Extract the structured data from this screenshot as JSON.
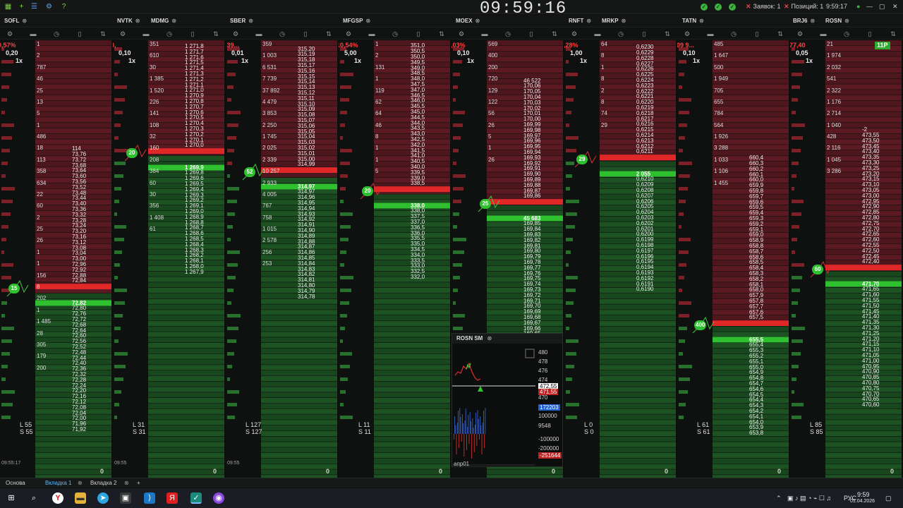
{
  "clock": "09:59:16",
  "status": {
    "orders_label": "Заявок: 1",
    "positions_label": "Позиций: 1",
    "server_time": "9:59:17"
  },
  "tickers": [
    {
      "name": "SOFL"
    },
    {
      "name": "NVTK"
    },
    {
      "name": "MDMG"
    },
    {
      "name": "SBER"
    },
    {
      "name": "MFGSP"
    },
    {
      "name": "MOEX"
    },
    {
      "name": "RNFT"
    },
    {
      "name": "MRKP"
    },
    {
      "name": "TATN"
    },
    {
      "name": "BRJ6"
    },
    {
      "name": "ROSN"
    }
  ],
  "panels": [
    {
      "sym": "SOFL",
      "spread_pct": "-0,57%",
      "step": "0,20",
      "mult": "1x",
      "l": "L 55",
      "s": "S 55",
      "zero": "0",
      "time": "09:55:17",
      "asks": [
        "114",
        "73,76",
        "73,72",
        "73,68",
        "73,64",
        "73,60",
        "73,56",
        "73,52",
        "73,48",
        "73,44",
        "73,40",
        "73,36",
        "73,32",
        "73,28",
        "73,24",
        "73,20",
        "73,16",
        "73,12",
        "73,08",
        "73,04",
        "73,00",
        "72,96",
        "72,92",
        "72,88",
        "72,84"
      ],
      "bids": [
        "72,80",
        "72,76",
        "72,72",
        "72,68",
        "72,64",
        "72,60",
        "72,56",
        "72,52",
        "72,48",
        "72,44",
        "72,40",
        "72,36",
        "72,32",
        "72,28",
        "72,24",
        "72,20",
        "72,16",
        "72,12",
        "72,08",
        "72,04",
        "72,00",
        "71,96",
        "71,92"
      ],
      "sizes": [
        "1",
        "2",
        "787",
        "46",
        "25",
        "13",
        "5",
        "1",
        "486",
        "18",
        "113",
        "358",
        "634",
        "22",
        "60",
        "2",
        "25",
        "26",
        "1",
        "1",
        "156",
        "8",
        "202",
        "1",
        "1 485",
        "28",
        "305",
        "179",
        "200"
      ],
      "bestbid": "72,82",
      "marker": "15"
    },
    {
      "sym": "MDMG",
      "spread_pct": "-0,",
      "step": "0,10",
      "mult": "1x",
      "l": "L 31",
      "s": "S 31",
      "zero": "0",
      "time": "09:55",
      "asks": [
        "1 276",
        "1 271,9",
        "1 271,8",
        "1 271,7",
        "1 271,6",
        "1 271,5",
        "1 271,4",
        "1 271,3",
        "1 271,2",
        "1 271,1",
        "1 271,0",
        "1 270,9",
        "1 270,8",
        "1 270,7",
        "1 270,6",
        "1 270,5",
        "1 270,4",
        "1 270,3",
        "1 270,2",
        "1 270,1",
        "1 270,0"
      ],
      "bids": [
        "1 269,8",
        "1 269,6",
        "1 269,5",
        "1 269,4",
        "1 269,3",
        "1 269,2",
        "1 269,1",
        "1 269,0",
        "1 268,9",
        "1 268,8",
        "1 268,7",
        "1 268,6",
        "1 268,5",
        "1 268,4",
        "1 268,3",
        "1 268,2",
        "1 268,1",
        "1 268,0",
        "1 267,9"
      ],
      "sizes": [
        "351",
        "610",
        "30",
        "1 385",
        "1 520",
        "226",
        "141",
        "108",
        "32",
        "160",
        "208",
        "384",
        "60",
        "30",
        "356",
        "1 408",
        "61"
      ],
      "bestbid": "1 269,9",
      "marker": "20"
    },
    {
      "sym": "SBER",
      "spread_pct": "3 39...",
      "step": "0,01",
      "mult": "1x",
      "l": "L 127",
      "s": "S 127",
      "zero": "0",
      "time": "09:55",
      "asks": [
        "315,20",
        "315,19",
        "315,18",
        "315,17",
        "315,16",
        "315,15",
        "315,14",
        "315,13",
        "315,12",
        "315,11",
        "315,10",
        "315,09",
        "315,08",
        "315,07",
        "315,06",
        "315,05",
        "315,04",
        "315,03",
        "315,02",
        "315,01",
        "315,00",
        "314,99"
      ],
      "bids": [
        "314,97",
        "314,96",
        "314,95",
        "314,94",
        "314,93",
        "314,92",
        "314,91",
        "314,90",
        "314,89",
        "314,88",
        "314,87",
        "314,86",
        "314,85",
        "314,84",
        "314,83",
        "314,82",
        "314,81",
        "314,80",
        "314,79",
        "314,78"
      ],
      "sizes": [
        "359",
        "1 003",
        "6 531",
        "7 739",
        "37 892",
        "4 479",
        "3 853",
        "2 250",
        "1 745",
        "2 025",
        "2 339",
        "10 257",
        "2 933",
        "4 005",
        "767",
        "758",
        "1 015",
        "2 578",
        "256",
        "253"
      ],
      "bestbid": "314,97",
      "marker": "52"
    },
    {
      "sym": "MFGSP",
      "spread_pct": "-10,54%",
      "step": "5,00",
      "mult": "1x",
      "l": "L 11",
      "s": "S 11",
      "zero": "0",
      "time": "",
      "asks": [
        "2 358",
        "351,0",
        "350,5",
        "350,0",
        "349,5",
        "349,0",
        "348,5",
        "348,0",
        "347,5",
        "347,0",
        "346,5",
        "346,0",
        "345,5",
        "345,0",
        "344,5",
        "344,0",
        "343,5",
        "343,0",
        "342,5",
        "342,0",
        "341,5",
        "341,0",
        "340,5",
        "340,0",
        "339,5",
        "339,0",
        "338,5"
      ],
      "bids": [
        "338,0",
        "337,5",
        "337,0",
        "336,5",
        "336,0",
        "335,5",
        "335,0",
        "334,5",
        "334,0",
        "333,5",
        "333,0",
        "332,5",
        "332,0"
      ],
      "sizes": [
        "1",
        "2",
        "131",
        "1",
        "119",
        "62",
        "64",
        "46",
        "8",
        "1",
        "1",
        "5"
      ],
      "bestbid": "338,0",
      "marker": "20"
    },
    {
      "sym": "MOEX",
      "spread_pct": "0,03%",
      "step": "0,10",
      "mult": "1x",
      "l": "L 23",
      "s": "S 23",
      "zero": "0",
      "time": "09:55",
      "asks": [
        "46 522",
        "170,06",
        "170,05",
        "170,04",
        "170,03",
        "170,02",
        "170,01",
        "170,00",
        "169,99",
        "169,98",
        "169,97",
        "169,96",
        "169,95",
        "169,94",
        "169,93",
        "169,92",
        "169,91",
        "169,90",
        "169,89",
        "169,88",
        "169,87",
        "169,86"
      ],
      "bids": [
        "169,85",
        "169,84",
        "169,83",
        "169,82",
        "169,81",
        "169,80",
        "169,79",
        "169,78",
        "169,77",
        "169,76",
        "169,75",
        "169,74",
        "169,73",
        "169,72",
        "169,71",
        "169,70",
        "169,69",
        "169,68",
        "169,67",
        "169,66",
        "169,65",
        "169,64"
      ],
      "sizes": [
        "569",
        "400",
        "200",
        "720",
        "129",
        "122",
        "56",
        "26",
        "5",
        "1",
        "26"
      ],
      "bestbid": "45 683",
      "marker": "25"
    },
    {
      "sym": "MRKP",
      "spread_pct": "2,28%",
      "step": "1,00",
      "mult": "1x",
      "l": "L 0",
      "s": "S 0",
      "zero": "0",
      "time": "",
      "asks": [
        "2 735",
        "0,6230",
        "0,6229",
        "0,6228",
        "0,6227",
        "0,6226",
        "0,6225",
        "0,6224",
        "0,6223",
        "0,6222",
        "0,6221",
        "0,6220",
        "0,6219",
        "0,6218",
        "0,6217",
        "0,6216",
        "0,6215",
        "0,6214",
        "0,6213",
        "0,6212",
        "0,6211"
      ],
      "bids": [
        "0,6210",
        "0,6209",
        "0,6208",
        "0,6207",
        "0,6206",
        "0,6205",
        "0,6204",
        "0,6203",
        "0,6202",
        "0,6201",
        "0,6200",
        "0,6199",
        "0,6198",
        "0,6197",
        "0,6196",
        "0,6195",
        "0,6194",
        "0,6193",
        "0,6192",
        "0,6191",
        "0,6190"
      ],
      "sizes": [
        "64",
        "8",
        "1",
        "8",
        "2",
        "8",
        "74",
        "29"
      ],
      "bestbid": "2 055",
      "marker": "29"
    },
    {
      "sym": "TATN",
      "spread_pct": "209 9...",
      "step": "0,10",
      "mult": "1x",
      "l": "L 61",
      "s": "S 61",
      "zero": "0",
      "time": "",
      "asks": [
        "660,4",
        "660,3",
        "660,2",
        "660,1",
        "660,0",
        "659,9",
        "659,8",
        "659,7",
        "659,6",
        "659,5",
        "659,4",
        "659,3",
        "659,2",
        "659,1",
        "659,0",
        "658,9",
        "658,8",
        "658,7",
        "658,6",
        "658,5",
        "658,4",
        "658,3",
        "658,2",
        "658,1",
        "658,0",
        "657,9",
        "657,8",
        "657,7",
        "657,6",
        "657,5"
      ],
      "bids": [
        "655,4",
        "655,3",
        "655,2",
        "655,1",
        "655,0",
        "654,9",
        "654,8",
        "654,7",
        "654,6",
        "654,5",
        "654,4",
        "654,3",
        "654,2",
        "654,1",
        "654,0",
        "653,9",
        "653,8"
      ],
      "sizes": [
        "485",
        "1 647",
        "500",
        "1 949",
        "705",
        "655",
        "784",
        "564",
        "1 926",
        "3 288",
        "1 033",
        "1 106",
        "1 455"
      ],
      "bestbid": "655,5",
      "marker": "400"
    },
    {
      "sym": "ROSN",
      "spread_pct": "477,40",
      "step": "0,05",
      "mult": "1x",
      "l": "L 85",
      "s": "S 85",
      "zero": "0",
      "time": "",
      "asks": [
        "-2",
        "473,55",
        "473,50",
        "473,45",
        "473,40",
        "473,35",
        "473,30",
        "473,25",
        "473,20",
        "473,15",
        "473,10",
        "473,05",
        "473,00",
        "472,95",
        "472,90",
        "472,85",
        "472,80",
        "472,75",
        "472,70",
        "472,65",
        "472,60",
        "472,55",
        "472,50",
        "472,45",
        "472,40"
      ],
      "bids": [
        "471,65",
        "471,60",
        "471,55",
        "471,50",
        "471,45",
        "471,40",
        "471,35",
        "471,30",
        "471,25",
        "471,20",
        "471,15",
        "471,10",
        "471,05",
        "471,00",
        "470,95",
        "470,90",
        "470,85",
        "470,80",
        "470,75",
        "470,70",
        "470,65",
        "470,60"
      ],
      "sizes": [
        "21",
        "1 974",
        "2 032",
        "541",
        "2 322",
        "1 176",
        "2 714",
        "1 040",
        "428",
        "2 116",
        "1 045",
        "3 286"
      ],
      "bestbid": "471,70",
      "top_right": "11P",
      "marker": "60"
    }
  ],
  "rosn_sm": {
    "title": "ROSN SM",
    "price_axis": [
      "480",
      "478",
      "476",
      "474",
      "472",
      "470"
    ],
    "price_last": "472,55",
    "price_mid": "471,55",
    "vol_axis": [
      "172203",
      "100000",
      "9548",
      "-100000",
      "-200000",
      "-251644"
    ],
    "date": "апр01"
  },
  "tabs": [
    {
      "label": "Основа"
    },
    {
      "label": "Вкладка 1"
    },
    {
      "label": "Вкладка 2"
    }
  ],
  "taskbar": {
    "lang": "РУС",
    "time": "9:59",
    "date": "01.04.2026"
  },
  "colors": {
    "ask": "#6b1e26",
    "bid": "#1f5a24",
    "best_ask": "#e02828",
    "best_bid": "#2fc02f",
    "bg": "#0d0f0e"
  }
}
